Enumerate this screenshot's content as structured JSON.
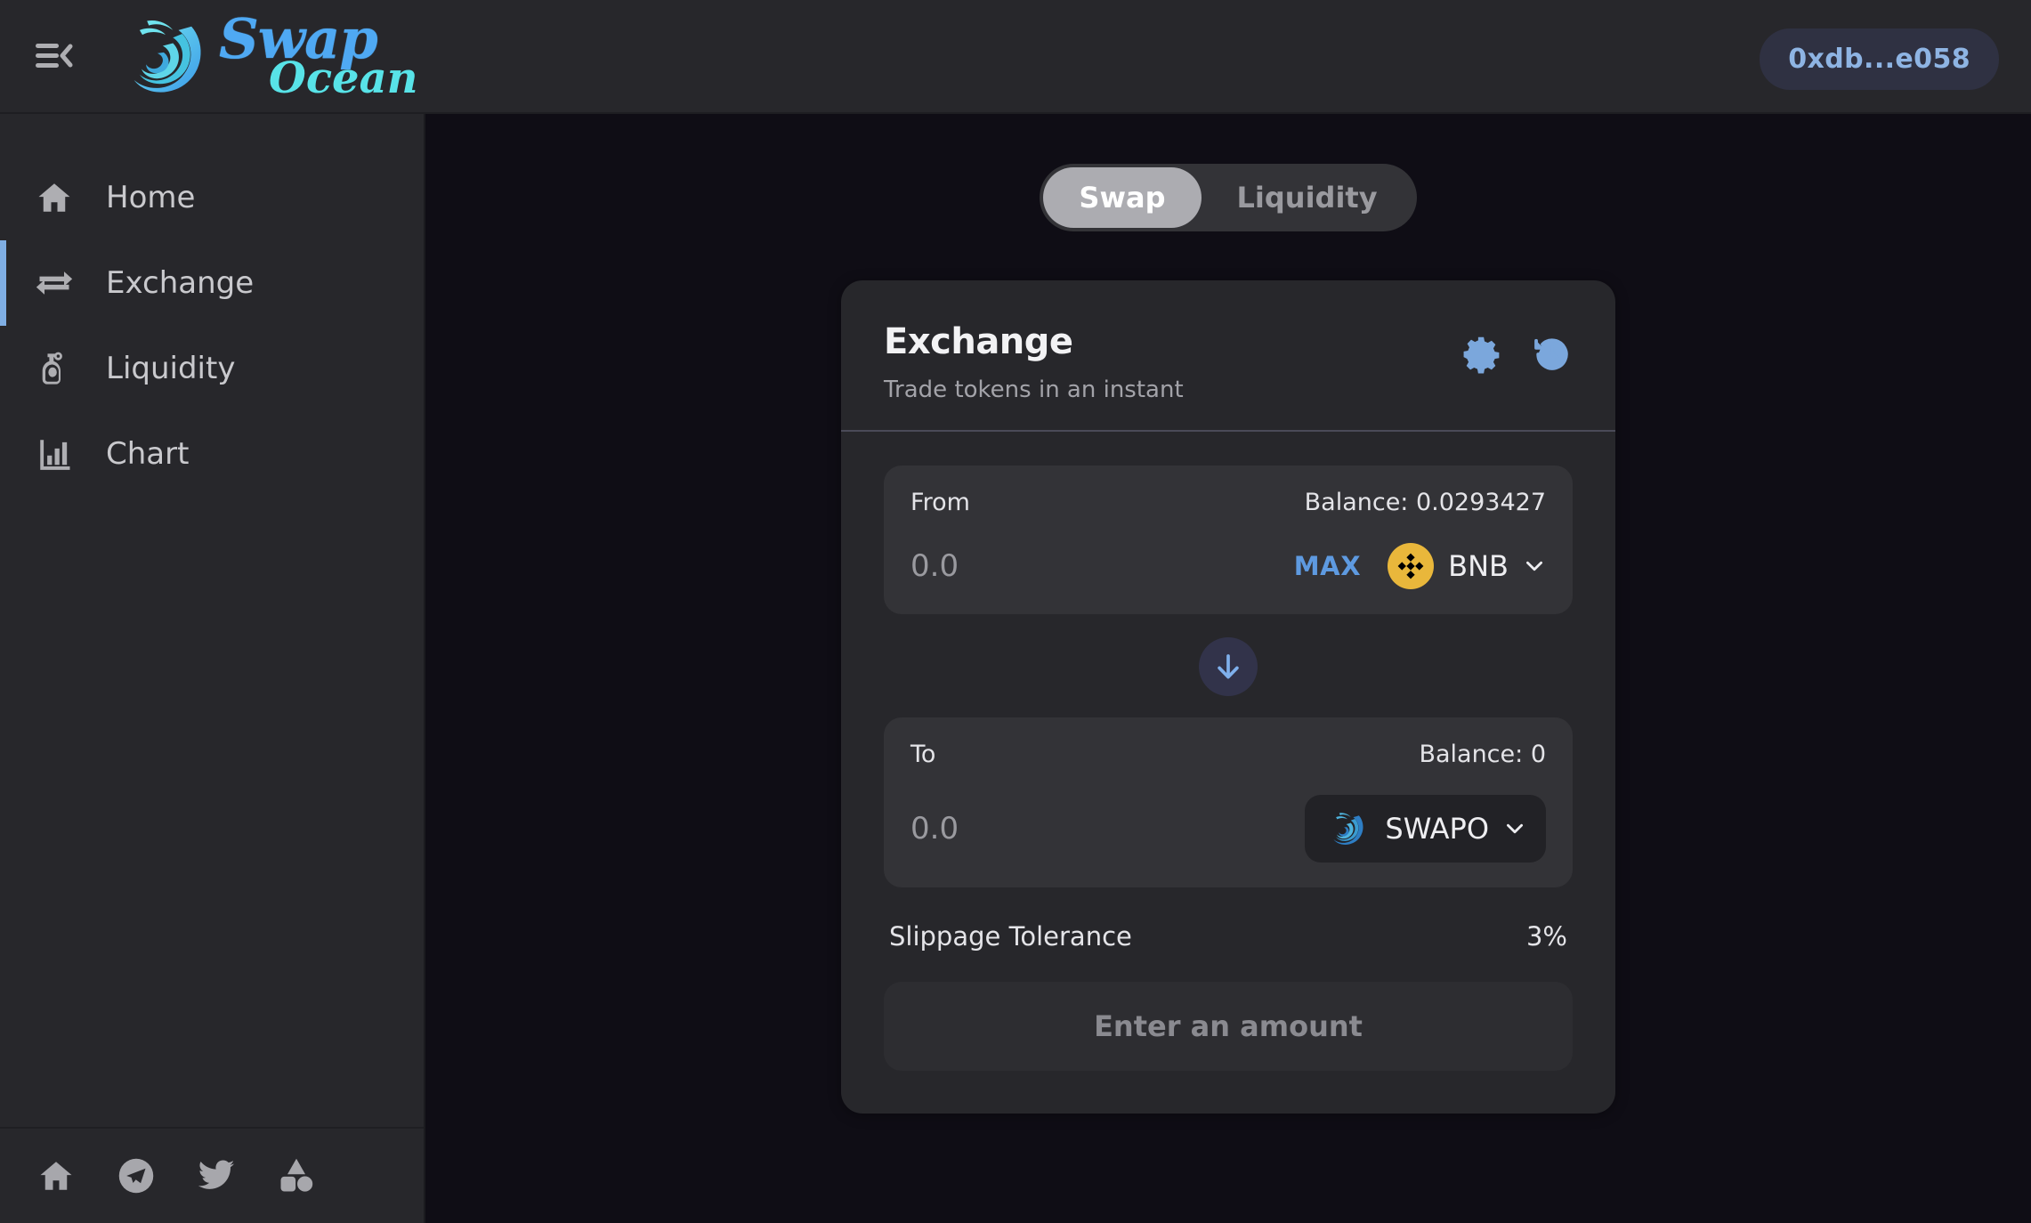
{
  "header": {
    "menu_icon": "hamburger-collapse-icon",
    "logo_line1": "Swap",
    "logo_line2": "Ocean",
    "wallet_address": "0xdb...e058"
  },
  "sidebar": {
    "items": [
      {
        "label": "Home",
        "icon": "home-icon",
        "active": false
      },
      {
        "label": "Exchange",
        "icon": "exchange-icon",
        "active": true
      },
      {
        "label": "Liquidity",
        "icon": "liquidity-icon",
        "active": false
      },
      {
        "label": "Chart",
        "icon": "chart-icon",
        "active": false
      }
    ],
    "socials": [
      {
        "name": "home-icon"
      },
      {
        "name": "telegram-icon"
      },
      {
        "name": "twitter-icon"
      },
      {
        "name": "shapes-icon"
      }
    ]
  },
  "main": {
    "tabs": [
      {
        "label": "Swap",
        "active": true
      },
      {
        "label": "Liquidity",
        "active": false
      }
    ],
    "card": {
      "title": "Exchange",
      "subtitle": "Trade tokens in an instant",
      "settings_icon": "gear-icon",
      "history_icon": "history-icon",
      "from": {
        "label": "From",
        "balance": "Balance: 0.0293427",
        "amount": "",
        "amount_placeholder": "0.0",
        "max_label": "MAX",
        "token": "BNB",
        "token_icon": "bnb-icon"
      },
      "swap_direction_icon": "arrow-down-icon",
      "to": {
        "label": "To",
        "balance": "Balance: 0",
        "amount": "",
        "amount_placeholder": "0.0",
        "token": "SWAPO",
        "token_icon": "swapo-icon"
      },
      "slippage_label": "Slippage Tolerance",
      "slippage_value": "3%",
      "action_label": "Enter an amount"
    }
  },
  "colors": {
    "accent_blue": "#7BA7DC",
    "max_blue": "#5E9AE0",
    "bnb_yellow": "#E9B73B",
    "logo_swap": "#4FA9F3",
    "logo_ocean": "#58E3E8",
    "page_bg": "#0f0d15",
    "panel_bg": "#27272b"
  }
}
